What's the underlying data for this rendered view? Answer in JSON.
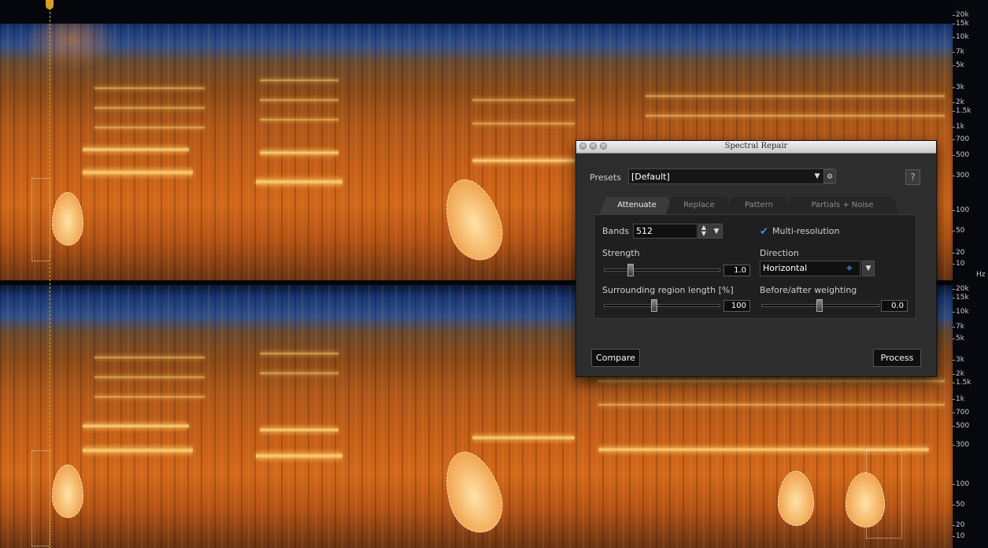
{
  "dialog": {
    "title": "Spectral Repair",
    "presets_label": "Presets",
    "preset_value": "[Default]",
    "help_label": "?",
    "tabs": [
      {
        "label": "Attenuate",
        "active": true
      },
      {
        "label": "Replace",
        "active": false
      },
      {
        "label": "Pattern",
        "active": false
      },
      {
        "label": "Partials + Noise",
        "active": false
      }
    ],
    "bands_label": "Bands",
    "bands_value": "512",
    "multires_label": "Multi-resolution",
    "multires_checked": true,
    "strength_label": "Strength",
    "strength_value": "1.0",
    "direction_label": "Direction",
    "direction_value": "Horizontal",
    "surrounding_label": "Surrounding region length [%]",
    "surrounding_value": "100",
    "weighting_label": "Before/after weighting",
    "weighting_value": "0.0",
    "compare_label": "Compare",
    "process_label": "Process"
  },
  "freq_axis": {
    "top": [
      "20k",
      "15k",
      "10k",
      "7k",
      "5k",
      "3k",
      "2k",
      "1.5k",
      "1k",
      "700",
      "500",
      "300",
      "100",
      "50",
      "20",
      "10"
    ],
    "unit": "Hz",
    "bottom": [
      "20k",
      "15k",
      "10k",
      "7k",
      "5k",
      "3k",
      "2k",
      "1.5k",
      "1k",
      "700",
      "500",
      "300",
      "100",
      "50",
      "20",
      "10"
    ]
  },
  "colors": {
    "accent": "#3d8ff0",
    "playhead": "#e6b22a"
  }
}
